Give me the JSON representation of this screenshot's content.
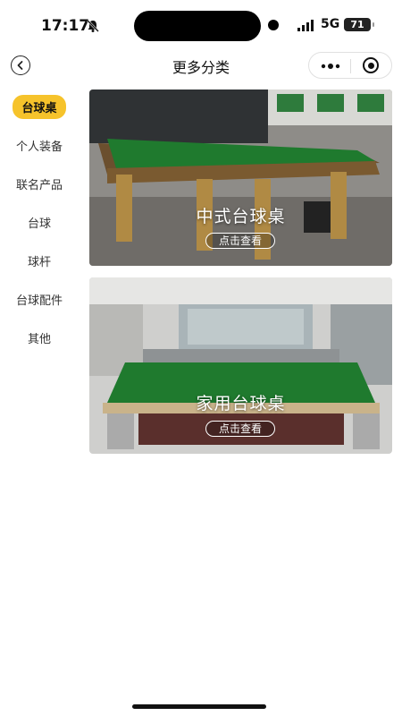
{
  "status": {
    "time": "17:17",
    "network": "5G",
    "battery": "71"
  },
  "nav": {
    "title": "更多分类"
  },
  "sidebar": {
    "items": [
      {
        "label": "台球桌",
        "active": true
      },
      {
        "label": "个人装备",
        "active": false
      },
      {
        "label": "联名产品",
        "active": false
      },
      {
        "label": "台球",
        "active": false
      },
      {
        "label": "球杆",
        "active": false
      },
      {
        "label": "台球配件",
        "active": false
      },
      {
        "label": "其他",
        "active": false
      }
    ]
  },
  "cards": [
    {
      "title": "中式台球桌",
      "button": "点击查看"
    },
    {
      "title": "家用台球桌",
      "button": "点击查看"
    }
  ],
  "colors": {
    "accent": "#f6c32b",
    "felt": "#1f7a2e"
  }
}
